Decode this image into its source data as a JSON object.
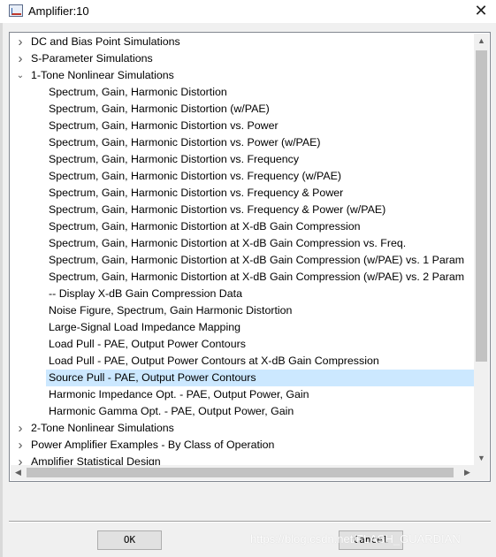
{
  "window": {
    "title": "Amplifier:10",
    "close_glyph": "✕",
    "icon": "amplifier-app-icon"
  },
  "tree": {
    "items": [
      {
        "label": "DC and Bias Point Simulations",
        "level": 0,
        "expander": "collapsed",
        "selected": false
      },
      {
        "label": "S-Parameter Simulations",
        "level": 0,
        "expander": "collapsed",
        "selected": false
      },
      {
        "label": "1-Tone Nonlinear Simulations",
        "level": 0,
        "expander": "expanded",
        "selected": false
      },
      {
        "label": "Spectrum, Gain, Harmonic Distortion",
        "level": 1,
        "expander": "none",
        "selected": false
      },
      {
        "label": "Spectrum, Gain, Harmonic Distortion (w/PAE)",
        "level": 1,
        "expander": "none",
        "selected": false
      },
      {
        "label": "Spectrum, Gain, Harmonic Distortion vs. Power",
        "level": 1,
        "expander": "none",
        "selected": false
      },
      {
        "label": "Spectrum, Gain, Harmonic Distortion vs. Power (w/PAE)",
        "level": 1,
        "expander": "none",
        "selected": false
      },
      {
        "label": "Spectrum, Gain, Harmonic Distortion vs. Frequency",
        "level": 1,
        "expander": "none",
        "selected": false
      },
      {
        "label": "Spectrum, Gain, Harmonic Distortion vs. Frequency (w/PAE)",
        "level": 1,
        "expander": "none",
        "selected": false
      },
      {
        "label": "Spectrum, Gain, Harmonic Distortion vs. Frequency & Power",
        "level": 1,
        "expander": "none",
        "selected": false
      },
      {
        "label": "Spectrum, Gain, Harmonic Distortion vs. Frequency & Power (w/PAE)",
        "level": 1,
        "expander": "none",
        "selected": false
      },
      {
        "label": "Spectrum, Gain, Harmonic Distortion at X-dB Gain Compression",
        "level": 1,
        "expander": "none",
        "selected": false
      },
      {
        "label": "Spectrum, Gain, Harmonic Distortion at X-dB Gain Compression vs. Freq.",
        "level": 1,
        "expander": "none",
        "selected": false
      },
      {
        "label": "Spectrum, Gain, Harmonic Distortion at X-dB Gain Compression (w/PAE) vs. 1 Param",
        "level": 1,
        "expander": "none",
        "selected": false
      },
      {
        "label": "Spectrum, Gain, Harmonic Distortion at X-dB Gain Compression (w/PAE) vs. 2 Param",
        "level": 1,
        "expander": "none",
        "selected": false
      },
      {
        "label": "-- Display X-dB Gain Compression Data",
        "level": 1,
        "expander": "none",
        "selected": false
      },
      {
        "label": "Noise Figure, Spectrum, Gain Harmonic Distortion",
        "level": 1,
        "expander": "none",
        "selected": false
      },
      {
        "label": "Large-Signal Load Impedance Mapping",
        "level": 1,
        "expander": "none",
        "selected": false
      },
      {
        "label": "Load Pull - PAE, Output Power Contours",
        "level": 1,
        "expander": "none",
        "selected": false
      },
      {
        "label": "Load Pull - PAE, Output Power Contours at X-dB Gain Compression",
        "level": 1,
        "expander": "none",
        "selected": false
      },
      {
        "label": "Source Pull - PAE, Output Power Contours",
        "level": 1,
        "expander": "none",
        "selected": true
      },
      {
        "label": "Harmonic Impedance Opt. - PAE, Output Power, Gain",
        "level": 1,
        "expander": "none",
        "selected": false
      },
      {
        "label": "Harmonic Gamma Opt. - PAE, Output Power, Gain",
        "level": 1,
        "expander": "none",
        "selected": false
      },
      {
        "label": "2-Tone Nonlinear Simulations",
        "level": 0,
        "expander": "collapsed",
        "selected": false
      },
      {
        "label": "Power Amplifier Examples - By Class of Operation",
        "level": 0,
        "expander": "collapsed",
        "selected": false
      },
      {
        "label": "Amplifier Statistical Design",
        "level": 0,
        "expander": "collapsed",
        "selected": false
      }
    ],
    "colors": {
      "selection": "#cce8ff"
    }
  },
  "scrollbars": {
    "up_arrow": "▲",
    "down_arrow": "▼",
    "left_arrow": "◀",
    "right_arrow": "▶"
  },
  "buttons": {
    "ok": "OK",
    "cancel": "Cancel"
  },
  "watermark": "https://blog.csdn.net/FLASH_GUARDIAN"
}
